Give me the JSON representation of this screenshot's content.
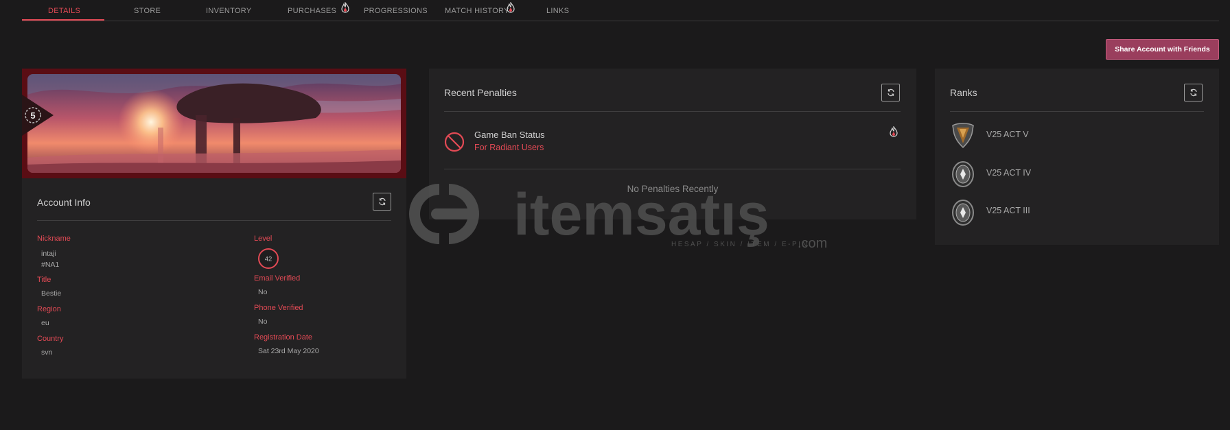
{
  "tabs": [
    {
      "label": "DETAILS",
      "active": true
    },
    {
      "label": "STORE"
    },
    {
      "label": "INVENTORY"
    },
    {
      "label": "PURCHASES",
      "badge": "flame-icon"
    },
    {
      "label": "PROGRESSIONS"
    },
    {
      "label": "MATCH HISTORY",
      "badge": "flame-icon"
    },
    {
      "label": "LINKS"
    }
  ],
  "share_button": "Share Account with Friends",
  "account": {
    "banner_level_badge": "5",
    "title": "Account Info",
    "fields": {
      "nickname_label": "Nickname",
      "nickname_value": "intaji",
      "tag_value": "#NA1",
      "title_label": "Title",
      "title_value": "Bestie",
      "region_label": "Region",
      "region_value": "eu",
      "country_label": "Country",
      "country_value": "svn",
      "level_label": "Level",
      "level_value": "42",
      "email_label": "Email Verified",
      "email_value": "No",
      "phone_label": "Phone Verified",
      "phone_value": "No",
      "registration_label": "Registration Date",
      "registration_value": "Sat 23rd May 2020"
    }
  },
  "penalties": {
    "title": "Recent Penalties",
    "ban_title": "Game Ban Status",
    "ban_subtitle": "For Radiant Users",
    "empty_text": "No Penalties Recently"
  },
  "ranks": {
    "title": "Ranks",
    "items": [
      {
        "label": "V25 ACT V",
        "icon": "bronze-rank-icon"
      },
      {
        "label": "V25 ACT IV",
        "icon": "iron-rank-icon"
      },
      {
        "label": "V25 ACT III",
        "icon": "iron-rank-icon"
      }
    ]
  },
  "watermark": {
    "brand": "itemsatış",
    "tagline": "HESAP / SKIN / ITEM / E-PIN",
    "suffix": ".com"
  },
  "colors": {
    "accent": "#e34a55",
    "share": "#9a3e5d",
    "card": "#232223",
    "background": "#1b1a1b"
  }
}
